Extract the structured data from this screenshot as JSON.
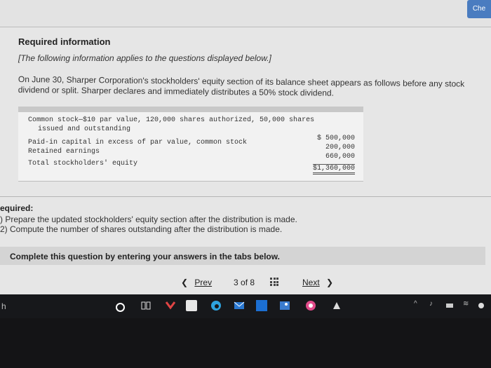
{
  "header": {
    "check_button": "Che"
  },
  "content": {
    "heading": "Required information",
    "info_note": "[The following information applies to the questions displayed below.]",
    "paragraph": "On June 30, Sharper Corporation's stockholders' equity section of its balance sheet appears as follows before any stock dividend or split. Sharper declares and immediately distributes a 50% stock dividend."
  },
  "equity_table": {
    "rows": [
      {
        "label": "Common stock—$10 par value, 120,000 shares authorized, 50,000 shares",
        "value": ""
      },
      {
        "label": "issued and outstanding",
        "value": "$  500,000"
      },
      {
        "label": "Paid-in capital in excess of par value, common stock",
        "value": "200,000"
      },
      {
        "label": "Retained earnings",
        "value": "660,000"
      },
      {
        "label": "Total stockholders' equity",
        "value": "$1,360,000"
      }
    ]
  },
  "requirements": {
    "title": "equired:",
    "part1": ") Prepare the updated stockholders' equity section after the distribution is made.",
    "part2": "2) Compute the number of shares outstanding after the distribution is made."
  },
  "instruction": "Complete this question by entering your answers in the tabs below.",
  "navigation": {
    "prev_label": "Prev",
    "page_current": "3",
    "page_of": "of 8",
    "next_label": "Next"
  },
  "taskbar": {
    "left_char": "h",
    "icons": [
      "cortana-circle-icon",
      "task-view-icon",
      "app-red-icon",
      "store-icon",
      "edge-icon",
      "mail-icon",
      "file-icon",
      "photos-icon",
      "app-white-icon"
    ]
  }
}
